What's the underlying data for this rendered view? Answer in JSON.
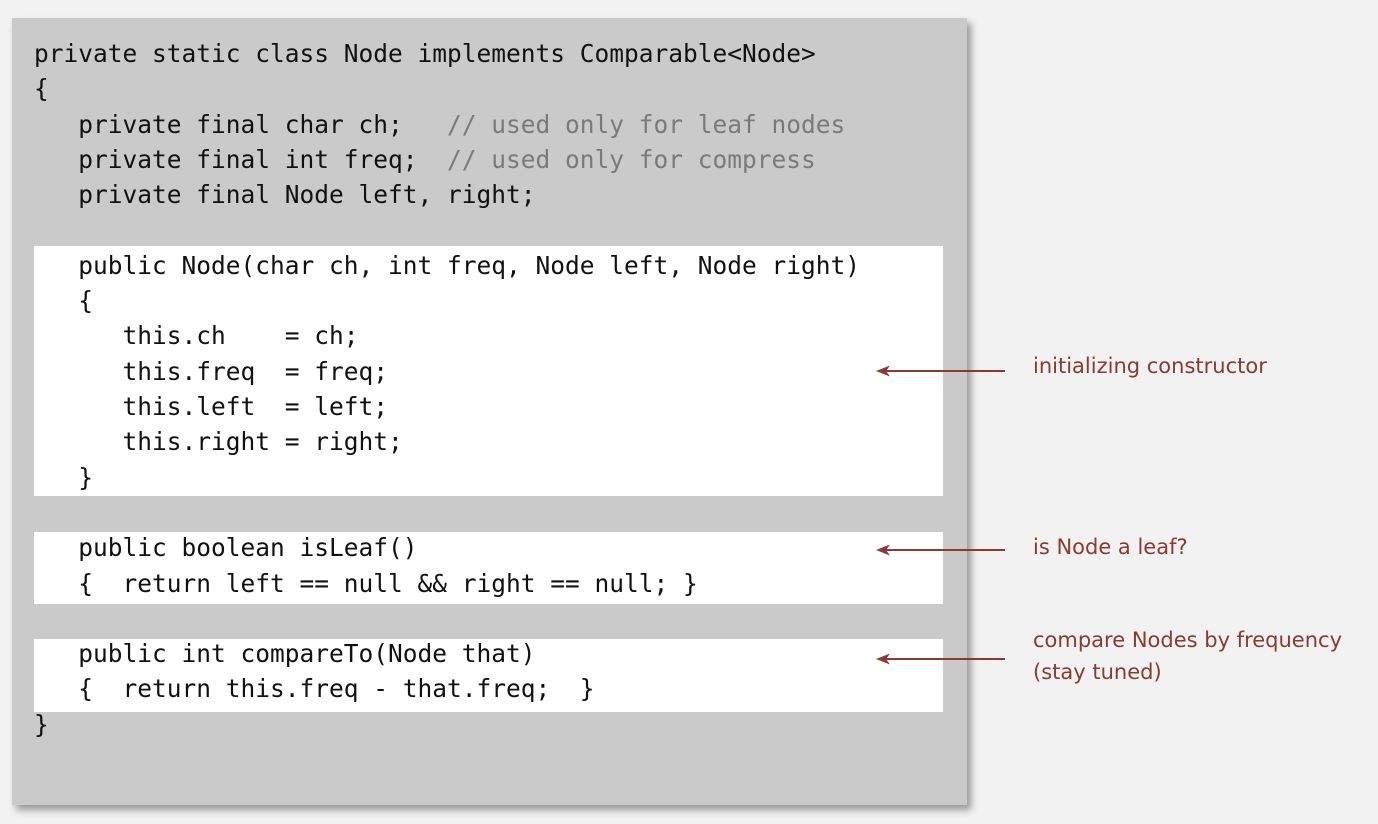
{
  "code": {
    "lines": [
      {
        "code": "private static class Node implements Comparable<Node>",
        "comment": ""
      },
      {
        "code": "{",
        "comment": ""
      },
      {
        "code": "   private final char ch;   ",
        "comment": "// used only for leaf nodes"
      },
      {
        "code": "   private final int freq;  ",
        "comment": "// used only for compress"
      },
      {
        "code": "   private final Node left, right;",
        "comment": ""
      },
      {
        "code": "",
        "comment": ""
      },
      {
        "code": "   public Node(char ch, int freq, Node left, Node right)",
        "comment": ""
      },
      {
        "code": "   {",
        "comment": ""
      },
      {
        "code": "      this.ch    = ch;",
        "comment": ""
      },
      {
        "code": "      this.freq  = freq;",
        "comment": ""
      },
      {
        "code": "      this.left  = left;",
        "comment": ""
      },
      {
        "code": "      this.right = right;",
        "comment": ""
      },
      {
        "code": "   }",
        "comment": ""
      },
      {
        "code": "",
        "comment": ""
      },
      {
        "code": "   public boolean isLeaf()",
        "comment": ""
      },
      {
        "code": "   {  return left == null && right == null; }",
        "comment": ""
      },
      {
        "code": "",
        "comment": ""
      },
      {
        "code": "   public int compareTo(Node that)",
        "comment": ""
      },
      {
        "code": "   {  return this.freq - that.freq;  }",
        "comment": ""
      },
      {
        "code": "}",
        "comment": ""
      }
    ]
  },
  "annotations": {
    "constructor": "initializing constructor",
    "is_leaf": "is Node a leaf?",
    "compare_line1": "compare Nodes by frequency",
    "compare_line2": "(stay tuned)"
  },
  "colors": {
    "annotation": "#8b3a32",
    "comment": "#7a7a7a",
    "panel": "#cacaca",
    "highlight": "#ffffff"
  }
}
